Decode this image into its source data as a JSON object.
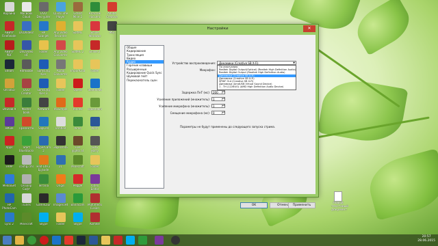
{
  "desktop": {
    "icons": [
      {
        "label": "Корзина",
        "color": "#d8d8d8"
      },
      {
        "label": "MacBook Cloud",
        "color": "#e9e9e9"
      },
      {
        "label": "DVD Decrypter",
        "color": "#6a6a6a"
      },
      {
        "label": "QuickTime Player",
        "color": "#4aa3df"
      },
      {
        "label": "Grand Mine 2",
        "color": "#9a6b3d"
      },
      {
        "label": "Классик пасьянс",
        "color": "#2f8d3a"
      },
      {
        "label": "Adobe Creative Cloud",
        "color": "#d43b2f"
      },
      {
        "label": "ABBYY FineReader",
        "color": "#c62828"
      },
      {
        "label": "DVDVideoSoft",
        "color": "#3a6fc2"
      },
      {
        "label": "HP Scanjet",
        "color": "#2677c9"
      },
      {
        "label": "Any Video Recorder",
        "color": "#e0b030"
      },
      {
        "label": "SoftMC",
        "color": "#e7c55a"
      },
      {
        "label": "Enlive Windows",
        "color": "#d9363e"
      },
      {
        "label": "MSI",
        "color": "#444444"
      },
      {
        "label": "ABBYY PDF",
        "color": "#b71c1c"
      },
      {
        "label": "DVDVideo HF",
        "color": "#3556a8"
      },
      {
        "label": "Folder",
        "color": "#e8c24c"
      },
      {
        "label": "Any Video Converter",
        "color": "#d34848"
      },
      {
        "label": "SoftMC 2",
        "color": "#e7c55a"
      },
      {
        "label": "Enlive 2",
        "color": "#c62828"
      },
      {
        "label": "",
        "color": "transparent"
      },
      {
        "label": "Steam",
        "color": "#1b2838"
      },
      {
        "label": "HitmBabe",
        "color": "#5a5a5a"
      },
      {
        "label": "Samsung Kies",
        "color": "#1e5bb5"
      },
      {
        "label": "Audio Converter",
        "color": "#777777"
      },
      {
        "label": "ImportGlobal",
        "color": "#e7c55a"
      },
      {
        "label": "Folder",
        "color": "#e7c55a"
      },
      {
        "label": "",
        "color": "transparent"
      },
      {
        "label": "UltraISO",
        "color": "#d2a23a"
      },
      {
        "label": "DVD Creator",
        "color": "#a74343"
      },
      {
        "label": "Samsung Kies 3",
        "color": "#1e5bb5"
      },
      {
        "label": "Folder",
        "color": "#e7c55a"
      },
      {
        "label": "Opera",
        "color": "#cc1b1b"
      },
      {
        "label": "TeamViewer",
        "color": "#1a73c8"
      },
      {
        "label": "",
        "color": "transparent"
      },
      {
        "label": "DVDFab 9",
        "color": "#c62828"
      },
      {
        "label": "Master book",
        "color": "#3a7d3a"
      },
      {
        "label": "AdAware",
        "color": "#444444"
      },
      {
        "label": "mkSimple",
        "color": "#e06a1a"
      },
      {
        "label": "Yandex",
        "color": "#e33a2b"
      },
      {
        "label": "squareland",
        "color": "#6a9a3a"
      },
      {
        "label": "",
        "color": "transparent"
      },
      {
        "label": "eMule",
        "color": "#5b3b9a"
      },
      {
        "label": "Презентации",
        "color": "#d04a2a"
      },
      {
        "label": "SlipCell",
        "color": "#2277bb"
      },
      {
        "label": "Untitled",
        "color": "#dddddd"
      },
      {
        "label": "Aimo",
        "color": "#3b8a3b"
      },
      {
        "label": "Word",
        "color": "#2b5797"
      },
      {
        "label": "",
        "color": "transparent"
      },
      {
        "label": "Apps",
        "color": "#cc2222"
      },
      {
        "label": "Start BlueStacks",
        "color": "#3aa13a"
      },
      {
        "label": "HyperCam 2",
        "color": "#2a6ab0"
      },
      {
        "label": "Звукозапись",
        "color": "#333333"
      },
      {
        "label": "Five nights at Freddy's",
        "color": "#6b4a2a"
      },
      {
        "label": "GOG Harry Potter",
        "color": "#555555"
      },
      {
        "label": "",
        "color": "transparent"
      },
      {
        "label": "FAAP",
        "color": "#1c1c1c"
      },
      {
        "label": "config.cmd",
        "color": "#bbbbbb"
      },
      {
        "label": "Half-Life 2 Episode One",
        "color": "#e07a1a"
      },
      {
        "label": "21",
        "color": "#2f6fb0"
      },
      {
        "label": "Minecraft",
        "color": "#5c8a2a"
      },
      {
        "label": "Folder",
        "color": "#e7c55a"
      },
      {
        "label": "",
        "color": "transparent"
      },
      {
        "label": "MediaGet",
        "color": "#2f7bd8"
      },
      {
        "label": "Ossianp Софт",
        "color": "#b0b0b0"
      },
      {
        "label": "Terraria",
        "color": "#3a8c3a"
      },
      {
        "label": "Origin",
        "color": "#f07c1a"
      },
      {
        "label": "Peggle",
        "color": "#d52a2a"
      },
      {
        "label": "Video Editor",
        "color": "#7a3a9a"
      },
      {
        "label": "",
        "color": "transparent"
      },
      {
        "label": "HP PhotoCam",
        "color": "#2266aa"
      },
      {
        "label": "iTunes",
        "color": "#d8d8d8"
      },
      {
        "label": "GameLaunch",
        "color": "#2a2a2a"
      },
      {
        "label": "ImageToHtml",
        "color": "#5a8ad0"
      },
      {
        "label": "Bandicam",
        "color": "#2a9a3a"
      },
      {
        "label": "Multimedia Fusion",
        "color": "#b03030"
      },
      {
        "label": "",
        "color": "transparent"
      },
      {
        "label": "Lync 2",
        "color": "#2a7ac8"
      },
      {
        "label": "Minecraft",
        "color": "#5c8a2a"
      },
      {
        "label": "Skype",
        "color": "#00aff0"
      },
      {
        "label": "Folder",
        "color": "#e7c55a"
      },
      {
        "label": "Skype",
        "color": "#00aff0"
      },
      {
        "label": "Komeie",
        "color": "#b03030"
      },
      {
        "label": "",
        "color": "transparent"
      }
    ]
  },
  "desktop_file": {
    "label": "Новый текстовый документ"
  },
  "dialog": {
    "title": "Настройки",
    "close": "✕",
    "categories": [
      "Общие",
      "Кодирование",
      "Трансляция",
      "Видео",
      "Аудио",
      "Горячие клавиши",
      "Расширенные",
      "Кодирование Quick Sync",
      "Шумовой гейт",
      "Переключатель сцен"
    ],
    "selected_category": "Аудио",
    "device_label": "Устройство воспроизведения:",
    "device_value": "Динамики (Creative SB X-Fi)",
    "mic_label": "Микрофон:",
    "dropdown_options": [
      "По умолчанию",
      "Realtek Digital Output(Optical) (Realtek High Definition Audio)",
      "Realtek Digital Output (Realtek High Definition Audio)",
      "Динамики (Creative SB X-Fi)",
      "Динамики (Creative SB X-Fi)",
      "SPDIF Out (Creative SB X-Fi)",
      "Динамики (AmdUSB Virtual Sound Device)",
      "1 - TH (1226UO) (AMD High Definition Audio Device)"
    ],
    "dropdown_selected_index": 3,
    "delay_label": "Задержка ПнТ (мс):",
    "delay_value": "200",
    "app_gain_label": "Усиление приложений (множитель):",
    "app_gain_value": "1",
    "mic_gain_label": "Усиление микрофона (множитель):",
    "mic_gain_value": "1",
    "mic_offset_label": "Смещение микрофона (мс):",
    "mic_offset_value": "0",
    "note": "Параметры не будут применены до следующего запуска стрима.",
    "ok": "OK",
    "cancel": "Отмена",
    "apply": "Применить"
  },
  "taskbar": {
    "time": "20:57",
    "date": "28.06.2015"
  }
}
